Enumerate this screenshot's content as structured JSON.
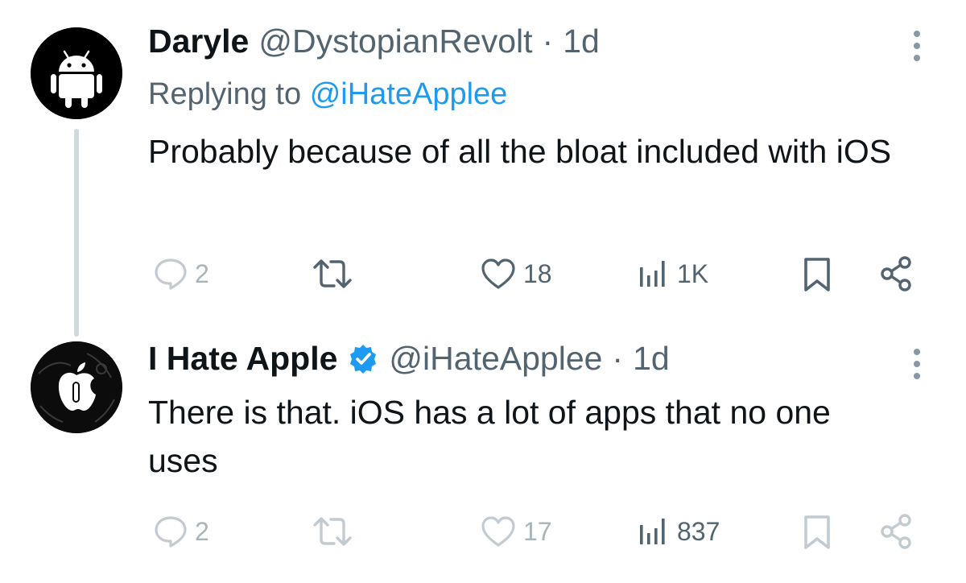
{
  "colors": {
    "text": "#0f1419",
    "secondary": "#536471",
    "accent": "#1d9bf0",
    "thread_line": "#cfd9de",
    "muted_icon": "#a9b4bd"
  },
  "tweets": [
    {
      "avatar_icon": "android-robot-icon",
      "name": "Daryle",
      "handle": "@DystopianRevolt",
      "separator": "·",
      "time": "1d",
      "replying_prefix": "Replying to",
      "replying_handle": "@iHateApplee",
      "text": "Probably because of all the bloat included with iOS",
      "actions": {
        "replies": "2",
        "retweets": "",
        "likes": "18",
        "views": "1K"
      }
    },
    {
      "avatar_icon": "apple-logo-icon",
      "name": "I Hate Apple",
      "verified": true,
      "handle": "@iHateApplee",
      "separator": "·",
      "time": "1d",
      "text": "There is that. iOS has a lot of apps that no one uses",
      "actions": {
        "replies": "2",
        "retweets": "",
        "likes": "17",
        "views": "837"
      }
    }
  ]
}
